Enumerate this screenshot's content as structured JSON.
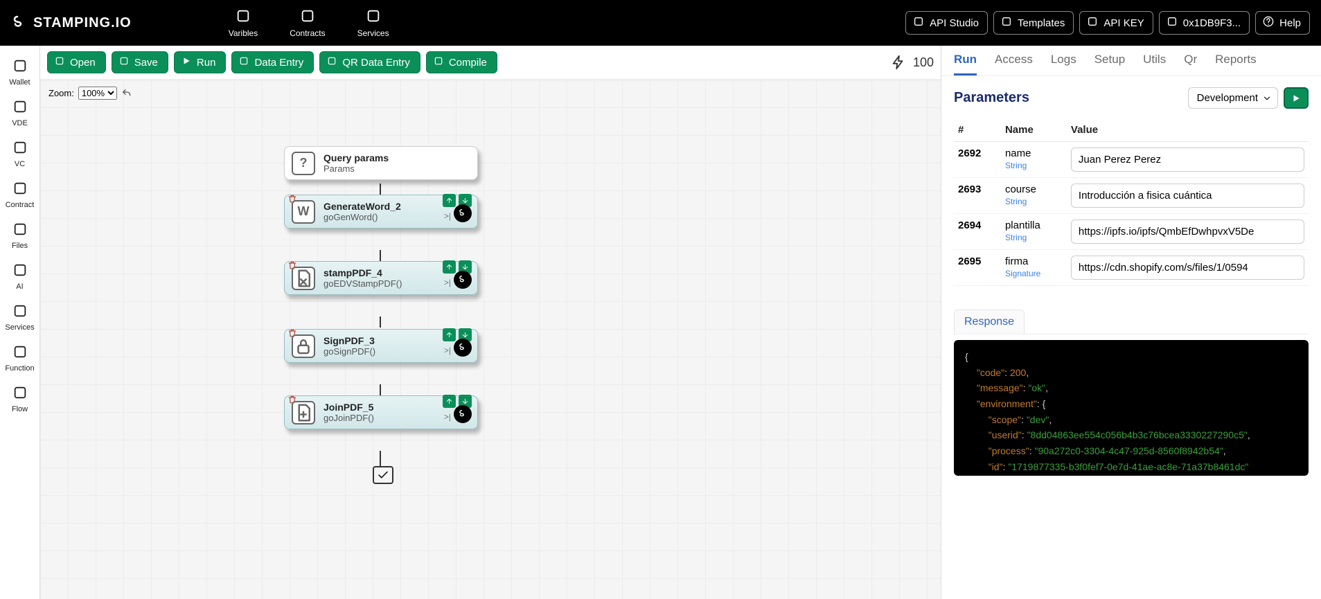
{
  "brand": "STAMPING.IO",
  "topnav": [
    {
      "label": "Varibles",
      "icon": "circles-icon"
    },
    {
      "label": "Contracts",
      "icon": "shapes-icon"
    },
    {
      "label": "Services",
      "icon": "barcode-icon"
    }
  ],
  "topbar_right": [
    {
      "label": "API Studio",
      "icon": "code-icon"
    },
    {
      "label": "Templates",
      "icon": "document-icon"
    },
    {
      "label": "API KEY",
      "icon": "settings-icon"
    },
    {
      "label": "0x1DB9F3...",
      "icon": "grid-icon"
    },
    {
      "label": "Help",
      "icon": "help-icon"
    }
  ],
  "leftrail": [
    {
      "label": "Wallet",
      "icon": "wallet-icon"
    },
    {
      "label": "VDE",
      "icon": "bookmark-icon"
    },
    {
      "label": "VC",
      "icon": "doc-icon"
    },
    {
      "label": "Contract",
      "icon": "contract-icon"
    },
    {
      "label": "Files",
      "icon": "box-icon"
    },
    {
      "label": "AI",
      "icon": "ai-icon"
    },
    {
      "label": "Services",
      "icon": "share-icon"
    },
    {
      "label": "Function",
      "icon": "fn-icon"
    },
    {
      "label": "Flow",
      "icon": "flow-icon"
    }
  ],
  "canvas_toolbar": [
    {
      "label": "Open",
      "icon": "upload-icon"
    },
    {
      "label": "Save",
      "icon": "save-icon"
    },
    {
      "label": "Run",
      "icon": "play-icon"
    },
    {
      "label": "Data Entry",
      "icon": "form-icon"
    },
    {
      "label": "QR Data Entry",
      "icon": "qr-icon"
    },
    {
      "label": "Compile",
      "icon": "braces-icon"
    }
  ],
  "canvas": {
    "count": "100",
    "zoom_label": "Zoom:",
    "zoom_value": "100%"
  },
  "flow": [
    {
      "title": "Query params",
      "sub": "Params",
      "glyph": "?",
      "plain": true
    },
    {
      "title": "GenerateWord_2",
      "sub": "goGenWord()",
      "glyph": "W"
    },
    {
      "title": "stampPDF_4",
      "sub": "goEDVStampPDF()",
      "glyph": "pdf"
    },
    {
      "title": "SignPDF_3",
      "sub": "goSignPDF()",
      "glyph": "lock"
    },
    {
      "title": "JoinPDF_5",
      "sub": "goJoinPDF()",
      "glyph": "plus"
    }
  ],
  "panel_tabs": [
    "Run",
    "Access",
    "Logs",
    "Setup",
    "Utils",
    "Qr",
    "Reports"
  ],
  "panel_active_tab": "Run",
  "panel_heading": "Parameters",
  "env_selected": "Development",
  "param_headers": {
    "num": "#",
    "name": "Name",
    "value": "Value"
  },
  "params": [
    {
      "num": "2692",
      "name": "name",
      "type": "String",
      "value": "Juan Perez Perez"
    },
    {
      "num": "2693",
      "name": "course",
      "type": "String",
      "value": "Introducción a fisica cuántica"
    },
    {
      "num": "2694",
      "name": "plantilla",
      "type": "String",
      "value": "https://ipfs.io/ipfs/QmbEfDwhpvxV5De"
    },
    {
      "num": "2695",
      "name": "firma",
      "type": "Signature",
      "value": "https://cdn.shopify.com/s/files/1/0594"
    }
  ],
  "response_tab_label": "Response",
  "response": {
    "code": 200,
    "message": "ok",
    "env_scope": "dev",
    "userid": "8dd04863ee554c056b4b3c76bcea3330227290c5",
    "process": "90a272c0-3304-4c47-925d-8560f8942b54",
    "id": "1719877335-b3f0fef7-0e7d-41ae-ac8e-71a37b8461dc"
  }
}
